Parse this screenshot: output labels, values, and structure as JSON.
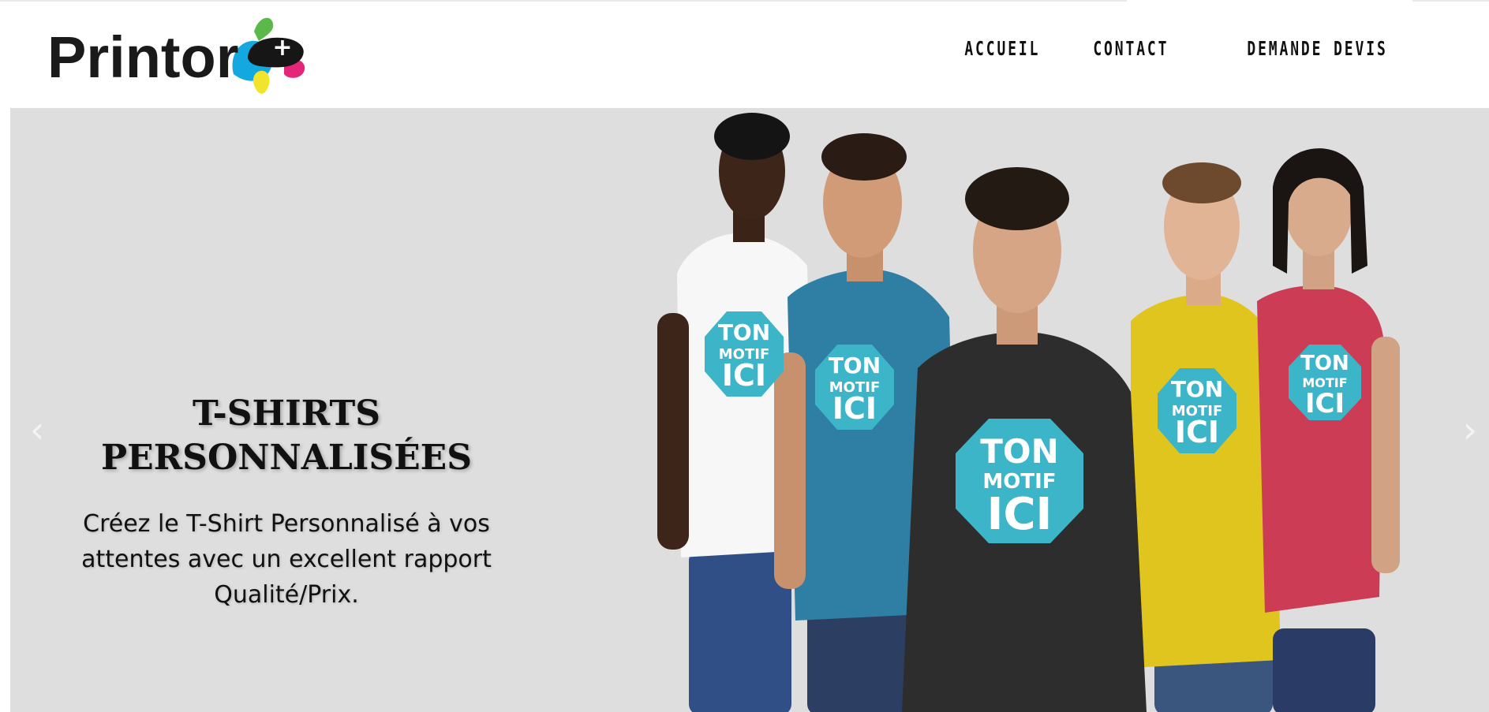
{
  "header": {
    "logo_text": "Printor",
    "logo_plus": "+"
  },
  "nav": {
    "items": [
      {
        "label": "ACCUEIL"
      },
      {
        "label": "CONTACT"
      },
      {
        "label": "DEMANDE DEVIS"
      }
    ]
  },
  "hero": {
    "title_line1": "T-SHIRTS",
    "title_line2": "PERSONNALISÉES",
    "text": "Créez le T-Shirt Personnalisé à vos attentes avec un excellent rapport Qualité/Prix.",
    "prev_label": "‹",
    "next_label": "›",
    "badge": {
      "line1": "TON",
      "line2": "MOTIF",
      "line3": "ICI",
      "color": "#3db5c8"
    },
    "shirt_colors": [
      "#f7f7f7",
      "#2e7fa3",
      "#2d2d2d",
      "#e0c51f",
      "#cc3d55"
    ]
  }
}
